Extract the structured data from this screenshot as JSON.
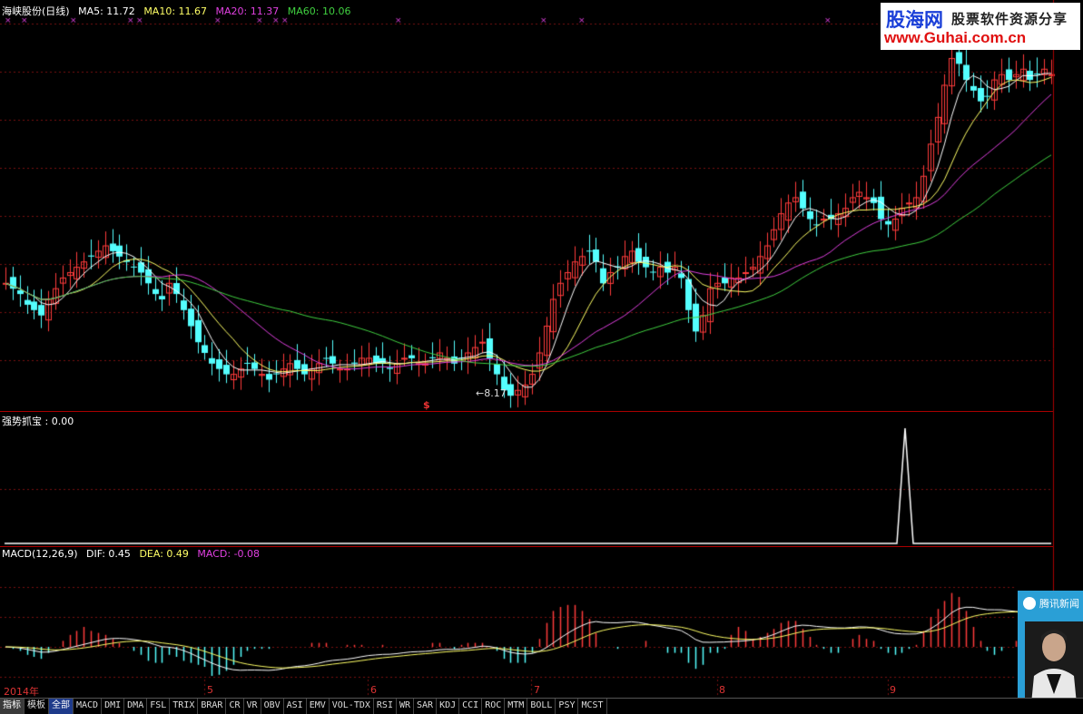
{
  "header": {
    "title": "海峡股份(日线)",
    "ma5": "MA5: 11.72",
    "ma10": "MA10: 11.67",
    "ma20": "MA20: 11.37",
    "ma60": "MA60: 10.06",
    "colors": {
      "ma5": "#ffffff",
      "ma10": "#ffff66",
      "ma20": "#e040e0",
      "ma60": "#40d040"
    }
  },
  "annotations": {
    "low_price": "←8.17",
    "signal_mark": "$"
  },
  "indicator": {
    "label": "强势抓宝 : 0.00"
  },
  "macd": {
    "title": "MACD(12,26,9)",
    "dif": "DIF: 0.45",
    "dea": "DEA: 0.49",
    "macd": "MACD: -0.08"
  },
  "xaxis": {
    "labels": [
      "2014年",
      "5",
      "6",
      "7",
      "8",
      "9"
    ]
  },
  "watermark": {
    "brand": "股海网",
    "slogan": "股票软件资源分享",
    "url": "www.Guhai.com.cn"
  },
  "popup": {
    "title": "腾讯新闻"
  },
  "tabs": [
    "指标",
    "模板",
    "全部",
    "MACD",
    "DMI",
    "DMA",
    "FSL",
    "TRIX",
    "BRAR",
    "CR",
    "VR",
    "OBV",
    "ASI",
    "EMV",
    "VOL-TDX",
    "RSI",
    "WR",
    "SAR",
    "KDJ",
    "CCI",
    "ROC",
    "MTM",
    "BOLL",
    "PSY",
    "MCST"
  ],
  "chart_data": {
    "type": "candlestick",
    "y_range": [
      8.0,
      15.0
    ],
    "closes": [
      10.3,
      10.2,
      10.1,
      9.9,
      9.8,
      9.7,
      10.0,
      10.2,
      10.4,
      10.5,
      10.6,
      10.7,
      10.8,
      10.9,
      11.0,
      10.9,
      10.8,
      10.7,
      10.6,
      10.5,
      10.3,
      10.1,
      10.0,
      10.3,
      10.1,
      9.8,
      9.5,
      9.2,
      9.0,
      8.8,
      8.7,
      8.6,
      8.6,
      8.7,
      8.8,
      8.7,
      8.6,
      8.5,
      8.6,
      8.7,
      8.8,
      8.7,
      8.6,
      8.7,
      8.8,
      8.9,
      8.8,
      8.7,
      8.7,
      8.8,
      8.9,
      8.9,
      8.8,
      8.8,
      8.7,
      8.8,
      8.9,
      8.9,
      8.8,
      8.8,
      8.9,
      9.0,
      8.9,
      8.8,
      8.9,
      9.0,
      9.1,
      9.2,
      8.9,
      8.6,
      8.3,
      8.2,
      8.3,
      8.4,
      8.6,
      9.0,
      9.5,
      10.0,
      10.3,
      10.5,
      10.7,
      10.8,
      10.9,
      10.7,
      10.3,
      10.5,
      10.6,
      10.8,
      10.9,
      10.7,
      10.6,
      10.5,
      10.6,
      10.5,
      10.6,
      10.4,
      9.8,
      9.4,
      9.7,
      10.2,
      10.3,
      10.3,
      10.4,
      10.4,
      10.5,
      10.6,
      10.8,
      11.0,
      11.3,
      11.6,
      11.8,
      11.9,
      11.7,
      11.5,
      11.4,
      11.5,
      11.5,
      11.6,
      11.7,
      11.9,
      12.0,
      11.9,
      11.8,
      11.5,
      11.4,
      11.5,
      11.7,
      11.8,
      11.9,
      12.3,
      12.9,
      13.4,
      14.0,
      14.5,
      14.4,
      14.1,
      13.9,
      13.7,
      13.8,
      14.1,
      14.2,
      14.1,
      14.2,
      14.3,
      14.1,
      14.2,
      14.3,
      14.2
    ],
    "ma60_range": [
      10.06,
      10.06
    ]
  }
}
